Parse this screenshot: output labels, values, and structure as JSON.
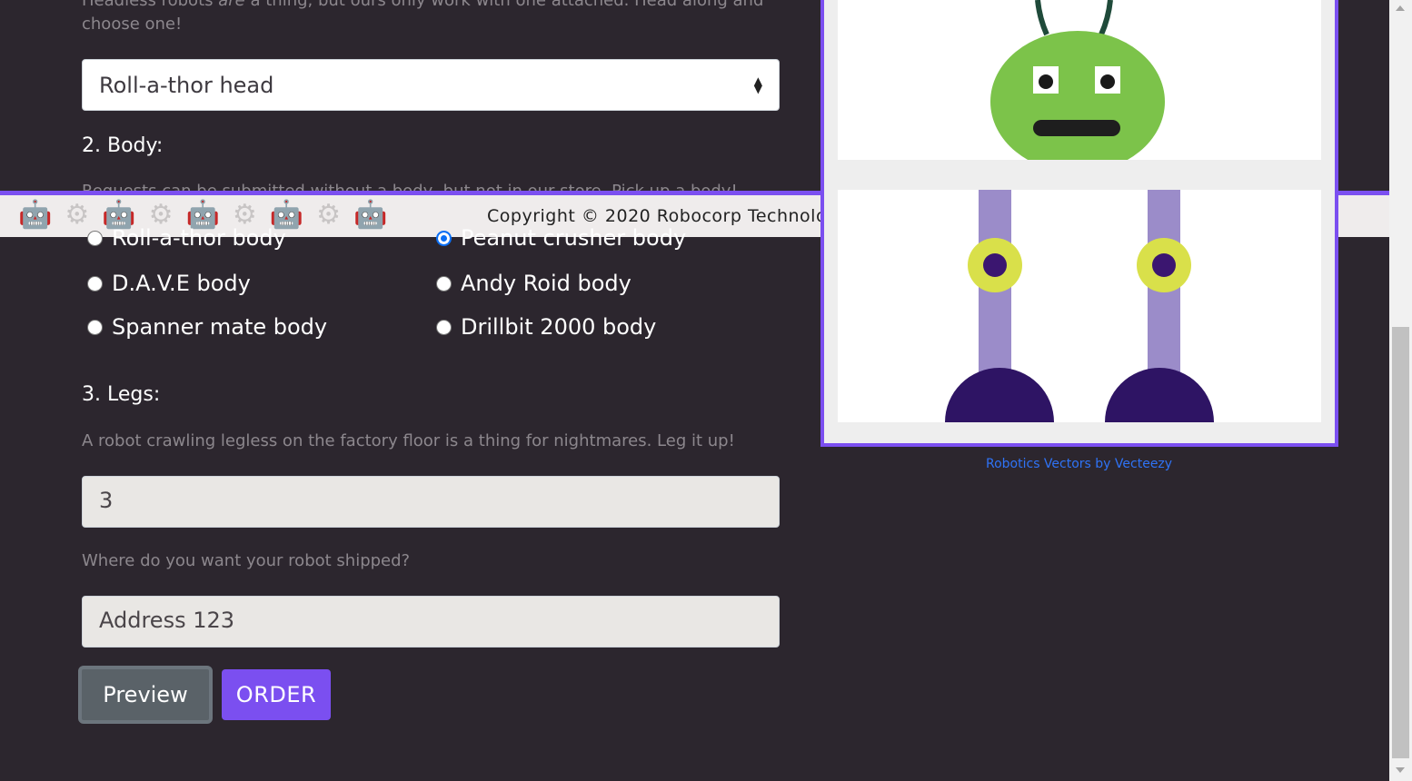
{
  "head_section": {
    "intro_before": "Headless robots ",
    "intro_em": "are",
    "intro_after": " a thing, but ours only work with one attached. Head along and choose one!",
    "selected_head": "Roll-a-thor head"
  },
  "body_section": {
    "heading": "2. Body:",
    "help": "Requests can be submitted without a body, but not in our store. Pick up a body!",
    "options": [
      {
        "label": "Roll-a-thor body",
        "selected": false
      },
      {
        "label": "Peanut crusher body",
        "selected": true
      },
      {
        "label": "D.A.V.E body",
        "selected": false
      },
      {
        "label": "Andy Roid body",
        "selected": false
      },
      {
        "label": "Spanner mate body",
        "selected": false
      },
      {
        "label": "Drillbit 2000 body",
        "selected": false
      }
    ]
  },
  "legs_section": {
    "heading": "3. Legs:",
    "help": "A robot crawling legless on the factory floor is a thing for nightmares. Leg it up!",
    "value": "3"
  },
  "shipping": {
    "help": "Where do you want your robot shipped?",
    "value": "Address 123"
  },
  "buttons": {
    "preview": "Preview",
    "order": "ORDER"
  },
  "footer": {
    "copyright": "Copyright © 2020 Robocorp Technolo"
  },
  "preview": {
    "credit": "Robotics Vectors by Vecteezy"
  },
  "colors": {
    "accent": "#7b4ff0",
    "background": "#2c262e",
    "link": "#2f73f6"
  }
}
